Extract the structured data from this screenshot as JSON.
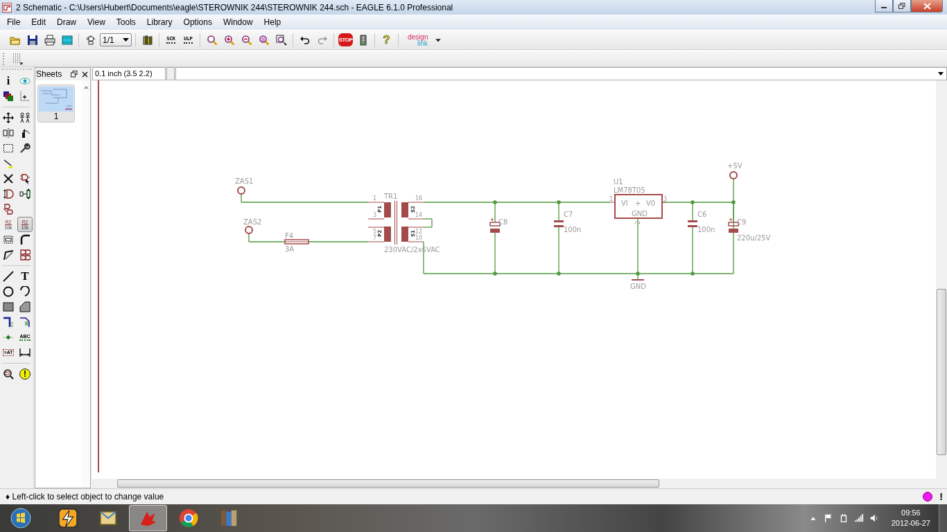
{
  "window": {
    "title": "2 Schematic - C:\\Users\\Hubert\\Documents\\eagle\\STEROWNIK 244\\STEROWNIK 244.sch - EAGLE 6.1.0 Professional"
  },
  "menu": [
    "File",
    "Edit",
    "Draw",
    "View",
    "Tools",
    "Library",
    "Options",
    "Window",
    "Help"
  ],
  "toolbar": [
    {
      "kind": "open"
    },
    {
      "kind": "save"
    },
    {
      "kind": "print"
    },
    {
      "kind": "cam"
    },
    {
      "kind": "sep"
    },
    {
      "kind": "gate"
    },
    {
      "kind": "select",
      "value": "1/1"
    },
    {
      "kind": "sep"
    },
    {
      "kind": "books"
    },
    {
      "kind": "sep"
    },
    {
      "kind": "script",
      "text": "SCR"
    },
    {
      "kind": "script",
      "text": "ULP"
    },
    {
      "kind": "sep"
    },
    {
      "kind": "zoomfit"
    },
    {
      "kind": "zoomin"
    },
    {
      "kind": "zoomout"
    },
    {
      "kind": "zoomredraw"
    },
    {
      "kind": "zoomselect"
    },
    {
      "kind": "sep"
    },
    {
      "kind": "undo"
    },
    {
      "kind": "redo"
    },
    {
      "kind": "sep"
    },
    {
      "kind": "stop",
      "text": "STOP"
    },
    {
      "kind": "go"
    },
    {
      "kind": "sep"
    },
    {
      "kind": "help",
      "text": "?"
    },
    {
      "kind": "sep"
    },
    {
      "kind": "logo",
      "text": "design",
      "text2": "link"
    }
  ],
  "toolbar2": [
    {
      "kind": "grid"
    }
  ],
  "palette": [
    {
      "kind": "info",
      "text": "i",
      "selected": false
    },
    {
      "kind": "eye",
      "selected": false
    },
    {
      "kind": "layers",
      "selected": false
    },
    {
      "kind": "mark",
      "selected": false
    },
    {
      "kind": "sep"
    },
    {
      "kind": "move",
      "selected": false
    },
    {
      "kind": "copy",
      "selected": false
    },
    {
      "kind": "mirror",
      "selected": false
    },
    {
      "kind": "rotate",
      "selected": false
    },
    {
      "kind": "group",
      "selected": false
    },
    {
      "kind": "wrench",
      "selected": false
    },
    {
      "kind": "paste",
      "selected": false
    },
    {
      "kind": "blank"
    },
    {
      "kind": "delete",
      "selected": false
    },
    {
      "kind": "add",
      "selected": false
    },
    {
      "kind": "pinswap",
      "selected": false
    },
    {
      "kind": "gateswap",
      "selected": false
    },
    {
      "kind": "replace",
      "selected": false
    },
    {
      "kind": "blank"
    },
    {
      "kind": "name",
      "text": "R2",
      "text2": "10k",
      "selected": false
    },
    {
      "kind": "value",
      "text": "R2",
      "text2": "10k",
      "selected": true
    },
    {
      "kind": "smash",
      "selected": false
    },
    {
      "kind": "miter",
      "selected": false
    },
    {
      "kind": "split",
      "selected": false
    },
    {
      "kind": "invoke",
      "selected": false
    },
    {
      "kind": "sep"
    },
    {
      "kind": "line",
      "selected": false
    },
    {
      "kind": "textglyph",
      "text": "T",
      "selected": false
    },
    {
      "kind": "circle",
      "selected": false
    },
    {
      "kind": "arc",
      "selected": false
    },
    {
      "kind": "rect",
      "selected": false
    },
    {
      "kind": "polygon",
      "selected": false
    },
    {
      "kind": "bus",
      "selected": false
    },
    {
      "kind": "net",
      "selected": false
    },
    {
      "kind": "junction",
      "selected": false
    },
    {
      "kind": "label",
      "text": "ABC",
      "selected": false
    },
    {
      "kind": "attribute",
      "text": ">AT",
      "selected": false
    },
    {
      "kind": "dimension",
      "selected": false
    },
    {
      "kind": "sep"
    },
    {
      "kind": "erc",
      "selected": false
    },
    {
      "kind": "errors",
      "text": "!",
      "selected": false
    }
  ],
  "sheets": {
    "title": "Sheets",
    "items": [
      {
        "label": "1",
        "selected": true
      }
    ]
  },
  "coordinates": "0.1 inch (3.5 2.2)",
  "schematic": {
    "terminals": [
      {
        "name": "ZAS1"
      },
      {
        "name": "ZAS2"
      },
      {
        "name": "+5V"
      }
    ],
    "fuse": {
      "name": "F4",
      "value": "3A"
    },
    "transformer": {
      "name": "TR1",
      "value": "230VAC/2x6VAC",
      "pins": [
        "1",
        "3",
        "5",
        "7",
        "16",
        "14",
        "12",
        "10"
      ],
      "windings": [
        "P1",
        "P2",
        "S2",
        "S1"
      ]
    },
    "capacitors": [
      {
        "name": "C8",
        "kind": "polarized"
      },
      {
        "name": "C7",
        "value": "100n",
        "kind": "plain"
      },
      {
        "name": "C6",
        "value": "100n",
        "kind": "plain"
      },
      {
        "name": "C9",
        "value": "220u/25V",
        "kind": "polarized"
      }
    ],
    "regulator": {
      "name": "U1",
      "value": "LM78T05",
      "pins": [
        "VI",
        "V0",
        "GND"
      ],
      "pin_numbers": [
        "1",
        "3",
        "2"
      ],
      "mark": "+"
    },
    "ground": {
      "name": "GND"
    }
  },
  "status": {
    "message": "♦ Left-click to select object to change value",
    "alert": "!"
  },
  "taskbar": {
    "apps": [
      {
        "kind": "winamp",
        "selected": false
      },
      {
        "kind": "mail",
        "selected": false
      },
      {
        "kind": "eagle",
        "selected": true
      },
      {
        "kind": "chrome",
        "selected": false
      },
      {
        "kind": "books",
        "selected": false
      }
    ],
    "tray": [
      {
        "kind": "up"
      },
      {
        "kind": "flag"
      },
      {
        "kind": "power"
      },
      {
        "kind": "signal"
      },
      {
        "kind": "speaker"
      }
    ],
    "time": "09:56",
    "date": "2012-06-27"
  }
}
